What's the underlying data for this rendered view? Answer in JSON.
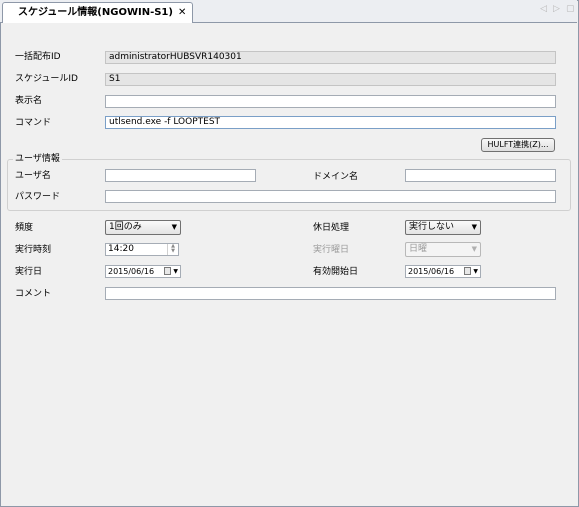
{
  "tab": {
    "title": "スケジュール情報(NGOWIN-S1)",
    "close": "✕"
  },
  "nav": {
    "prev": "◁",
    "next": "▷",
    "menu": "▢"
  },
  "form": {
    "batch_id_label": "一括配布ID",
    "batch_id_value": "administratorHUBSVR140301",
    "schedule_id_label": "スケジュールID",
    "schedule_id_value": "S1",
    "display_name_label": "表示名",
    "display_name_value": "",
    "command_label": "コマンド",
    "command_value": "utlsend.exe -f LOOPTEST",
    "hulft_button": "HULFT連携(Z)..."
  },
  "user_info": {
    "group_title": "ユーザ情報",
    "user_label": "ユーザ名",
    "user_value": "",
    "domain_label": "ドメイン名",
    "domain_value": "",
    "password_label": "パスワード",
    "password_value": ""
  },
  "schedule": {
    "frequency_label": "頻度",
    "frequency_value": "1回のみ",
    "holiday_label": "休日処理",
    "holiday_value": "実行しない",
    "time_label": "実行時刻",
    "time_value": "14:20",
    "weekday_label": "実行曜日",
    "weekday_value": "日曜",
    "date_label": "実行日",
    "date_value": "2015/06/16",
    "start_label": "有効開始日",
    "start_value": "2015/06/16",
    "comment_label": "コメント",
    "comment_value": ""
  }
}
